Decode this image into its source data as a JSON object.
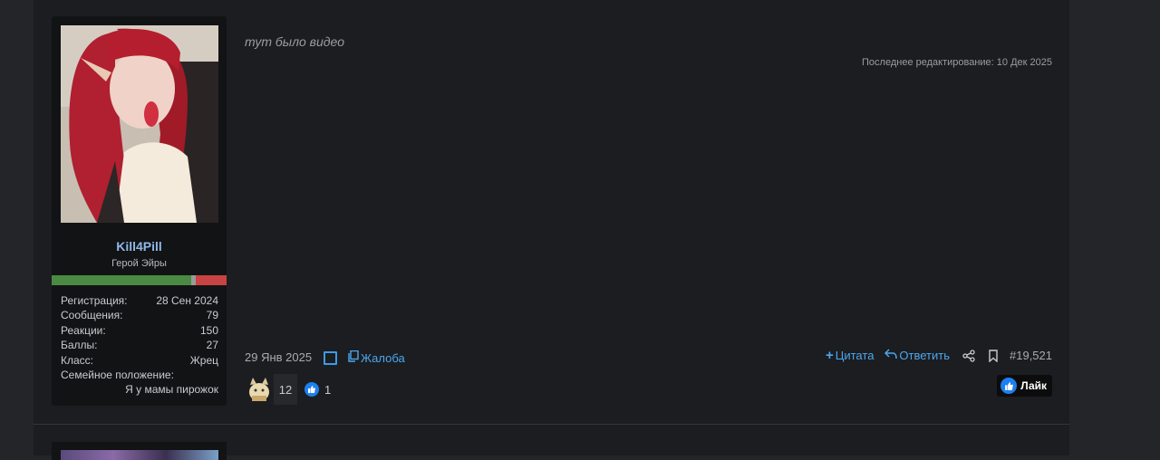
{
  "post": {
    "body_text": "тут было видео",
    "edited_label": "Последнее редактирование: 10 Дек 2025",
    "date": "29 Янв 2025",
    "report_label": "Жалоба",
    "quote_label": "Цитата",
    "reply_label": "Ответить",
    "post_number": "#19,521"
  },
  "user": {
    "name": "Kill4Pill",
    "title": "Герой Эйры",
    "stats": [
      {
        "label": "Регистрация:",
        "value": "28 Сен 2024"
      },
      {
        "label": "Сообщения:",
        "value": "79"
      },
      {
        "label": "Реакции:",
        "value": "150"
      },
      {
        "label": "Баллы:",
        "value": "27"
      },
      {
        "label": "Класс:",
        "value": "Жрец"
      },
      {
        "label": "Семейное положение:",
        "value": ""
      }
    ],
    "family_status": "Я у мамы пирожок"
  },
  "reactions": {
    "custom_count": "12",
    "like_count": "1",
    "like_button_label": "Лайк"
  },
  "colors": {
    "accent": "#4aa8f0",
    "username": "#8fb8e8",
    "rep_good": "#4a8a43",
    "rep_bad": "#c84343"
  }
}
